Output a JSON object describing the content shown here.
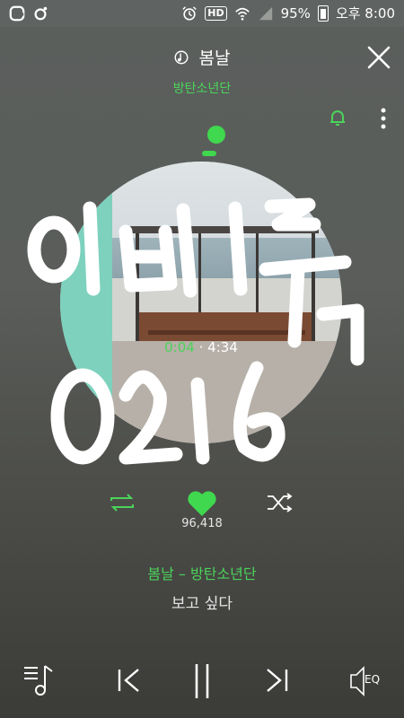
{
  "status_bar": {
    "battery": "95%",
    "time": "오후 8:00",
    "hd_label": "HD"
  },
  "player": {
    "song_title": "봄날",
    "artist": "방탄소년단",
    "current_time": "0:04",
    "separator": "·",
    "total_time": "4:34",
    "like_count": "96,418",
    "now_playing": "봄날 – 방탄소년단",
    "lyric": "보고 싶다",
    "progress": 0.015
  },
  "overlay_text": {
    "line1": "이쁘1둑",
    "line2": "0216"
  },
  "icons": {
    "close": "close-icon",
    "bell": "bell-icon",
    "more": "more-vertical-icon",
    "repeat": "repeat-icon",
    "heart": "heart-icon",
    "shuffle": "shuffle-icon",
    "playlist": "playlist-icon",
    "prev": "previous-icon",
    "pause": "pause-icon",
    "next": "next-icon",
    "eq": "equalizer-icon",
    "eq_label": "EQ"
  },
  "colors": {
    "accent": "#4bd35a",
    "teal": "#7dd1bd"
  }
}
